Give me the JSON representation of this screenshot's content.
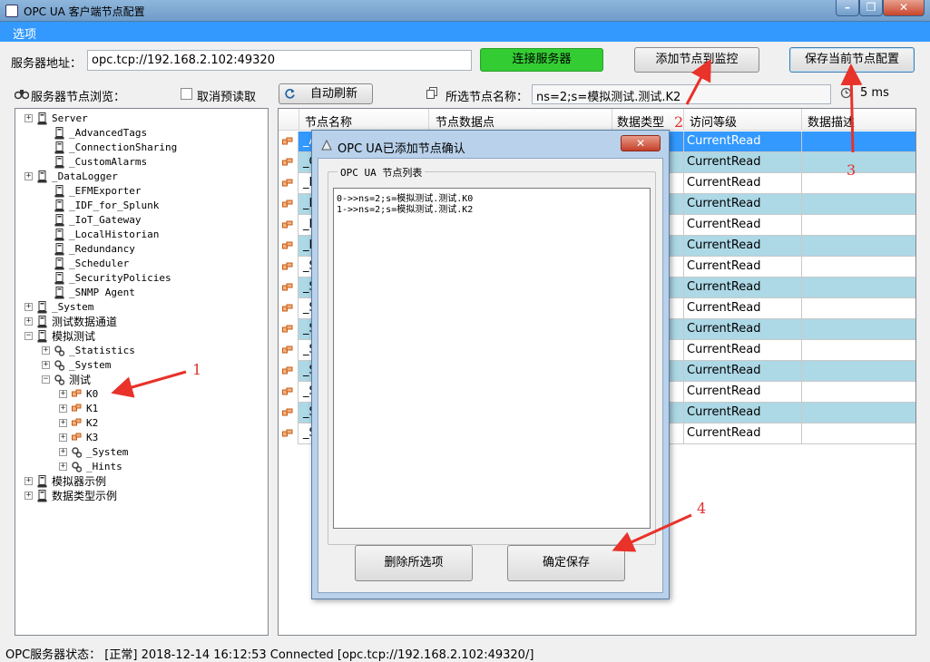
{
  "window": {
    "title": "OPC UA 客户端节点配置",
    "controls": {
      "minimize": "–",
      "maximize": "❐",
      "close": "✕"
    }
  },
  "menu": {
    "items": [
      "选项"
    ]
  },
  "server": {
    "address_label": "服务器地址：",
    "address_value": "opc.tcp://192.168.2.102:49320",
    "connect_label": "连接服务器",
    "add_monitor_label": "添加节点到监控",
    "save_config_label": "保存当前节点配置"
  },
  "toolbar": {
    "browse_label": "服务器节点浏览：",
    "cancel_preread_label": "取消预读取",
    "auto_refresh_label": "自动刷新",
    "selected_node_label": "所选节点名称：",
    "selected_node_value": "ns=2;s=模拟测试.测试.K2",
    "interval_text": "5 ms"
  },
  "tree": {
    "nodes": [
      {
        "label": "Server",
        "expander": "+"
      },
      {
        "label": "_AdvancedTags",
        "expander": ""
      },
      {
        "label": "_ConnectionSharing",
        "expander": ""
      },
      {
        "label": "_CustomAlarms",
        "expander": ""
      },
      {
        "label": "_DataLogger",
        "expander": "+"
      },
      {
        "label": "_EFMExporter",
        "expander": ""
      },
      {
        "label": "_IDF_for_Splunk",
        "expander": ""
      },
      {
        "label": "_IoT_Gateway",
        "expander": ""
      },
      {
        "label": "_LocalHistorian",
        "expander": ""
      },
      {
        "label": "_Redundancy",
        "expander": ""
      },
      {
        "label": "_Scheduler",
        "expander": ""
      },
      {
        "label": "_SecurityPolicies",
        "expander": ""
      },
      {
        "label": "_SNMP Agent",
        "expander": ""
      },
      {
        "label": "_System",
        "expander": "+"
      },
      {
        "label": "测试数据通道",
        "expander": "+"
      },
      {
        "label": "模拟测试",
        "expander": "−"
      },
      {
        "label": "_Statistics",
        "expander": "+"
      },
      {
        "label": "_System",
        "expander": "+"
      },
      {
        "label": "测试",
        "expander": "−"
      },
      {
        "label": "K0",
        "expander": "+"
      },
      {
        "label": "K1",
        "expander": "+"
      },
      {
        "label": "K2",
        "expander": "+"
      },
      {
        "label": "K3",
        "expander": "+"
      },
      {
        "label": "_System",
        "expander": "+"
      },
      {
        "label": "_Hints",
        "expander": "+"
      },
      {
        "label": "模拟器示例",
        "expander": "+"
      },
      {
        "label": "数据类型示例",
        "expander": "+"
      }
    ]
  },
  "grid": {
    "columns": [
      "节点名称",
      "节点数据点",
      "数据类型",
      "访问等级",
      "数据描述"
    ],
    "rows": [
      {
        "name": "_A",
        "access": "CurrentRead"
      },
      {
        "name": "_C",
        "access": "CurrentRead"
      },
      {
        "name": "_D",
        "access": "CurrentRead"
      },
      {
        "name": "_N",
        "access": "CurrentRead"
      },
      {
        "name": "_N",
        "access": "CurrentRead"
      },
      {
        "name": "_R",
        "access": "CurrentRead"
      },
      {
        "name": "_S",
        "access": "CurrentRead"
      },
      {
        "name": "_S",
        "access": "CurrentRead"
      },
      {
        "name": "_S",
        "access": "CurrentRead"
      },
      {
        "name": "_S",
        "access": "CurrentRead"
      },
      {
        "name": "_S",
        "access": "CurrentRead"
      },
      {
        "name": "_S",
        "access": "CurrentRead"
      },
      {
        "name": "_S",
        "access": "CurrentRead"
      },
      {
        "name": "_S",
        "access": "CurrentRead"
      },
      {
        "name": "_S",
        "access": "CurrentRead"
      }
    ]
  },
  "dialog": {
    "title": "OPC UA已添加节点确认",
    "close": "✕",
    "group_label": "OPC UA 节点列表",
    "list_items": [
      "0->>ns=2;s=模拟测试.测试.K0",
      "1->>ns=2;s=模拟测试.测试.K2"
    ],
    "delete_label": "删除所选项",
    "confirm_label": "确定保存"
  },
  "status": {
    "label": "OPC服务器状态：",
    "text": "[正常]   2018-12-14 16:12:53   Connected [opc.tcp://192.168.2.102:49320/]"
  },
  "annotations": [
    "1",
    "2",
    "3",
    "4"
  ],
  "colors": {
    "menu_bg": "#3399ff",
    "selected_row": "#3399ff",
    "alt_row": "#add8e6",
    "connect_button": "#33cc33",
    "annotation": "#e0302a"
  }
}
